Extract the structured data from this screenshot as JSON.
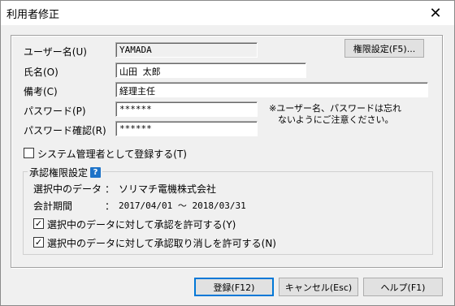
{
  "window": {
    "title": "利用者修正",
    "close_symbol": "✕"
  },
  "form": {
    "user_name_label": "ユーザー名(U)",
    "user_name_value": "YAMADA",
    "full_name_label": "氏名(O)",
    "full_name_value": "山田 太郎",
    "remarks_label": "備考(C)",
    "remarks_value": "経理主任",
    "password_label": "パスワード(P)",
    "password_value": "******",
    "password_confirm_label": "パスワード確認(R)",
    "password_confirm_value": "******",
    "note_line1": "※ユーザー名、パスワードは忘れ",
    "note_line2": "ないようにご注意ください。",
    "permission_button": "権限設定(F5)...",
    "admin_checkbox_label": "システム管理者として登録する(T)",
    "admin_checked": false
  },
  "approval": {
    "legend": "承認権限設定",
    "help_icon": "?",
    "data_label": "選択中のデータ",
    "data_sep": "：",
    "data_value": "ソリマチ電機株式会社",
    "period_label": "会計期間",
    "period_sep": "：",
    "period_value": "2017/04/01 ～ 2018/03/31",
    "allow_approve_label": "選択中のデータに対して承認を許可する(Y)",
    "allow_approve_checked": true,
    "allow_cancel_label": "選択中のデータに対して承認取り消しを許可する(N)",
    "allow_cancel_checked": true,
    "check_mark": "✓"
  },
  "footer": {
    "register_button": "登録(F12)",
    "cancel_button": "キャンセル(Esc)",
    "help_button": "ヘルプ(F1)"
  }
}
